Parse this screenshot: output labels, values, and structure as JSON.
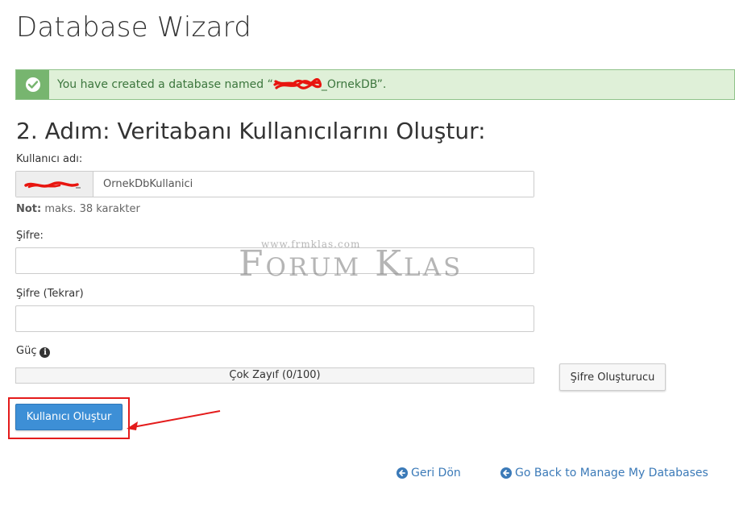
{
  "page": {
    "title": "Database Wizard"
  },
  "alert": {
    "text_before": "You have created a database named “",
    "text_after": "_OrnekDB”.",
    "icon": "check-circle-icon"
  },
  "step": {
    "title": "2. Adım: Veritabanı Kullanıcılarını Oluştur:"
  },
  "username": {
    "label": "Kullanıcı adı:",
    "value": "OrnekDbKullanici",
    "note_bold": "Not:",
    "note_text": " maks. 38 karakter"
  },
  "password": {
    "label": "Şifre:",
    "value": ""
  },
  "password_repeat": {
    "label": "Şifre (Tekrar)",
    "value": ""
  },
  "strength": {
    "label": "Güç",
    "text": "Çok Zayıf (0/100)",
    "value": 0,
    "icon": "info-circle-icon"
  },
  "buttons": {
    "generator": "Şifre Oluşturucu",
    "create_user": "Kullanıcı Oluştur"
  },
  "links": {
    "back": "Geri Dön",
    "manage": "Go Back to Manage My Databases",
    "icon": "arrow-left-circle-icon"
  },
  "watermark": {
    "url": "www.frmklas.com",
    "text": "Forum Klas"
  },
  "colors": {
    "success_bg": "#dff0d8",
    "success_icon_bg": "#77b56f",
    "primary": "#3d8fd6",
    "link": "#3b7ab8",
    "annotation_red": "#e41b1b"
  }
}
